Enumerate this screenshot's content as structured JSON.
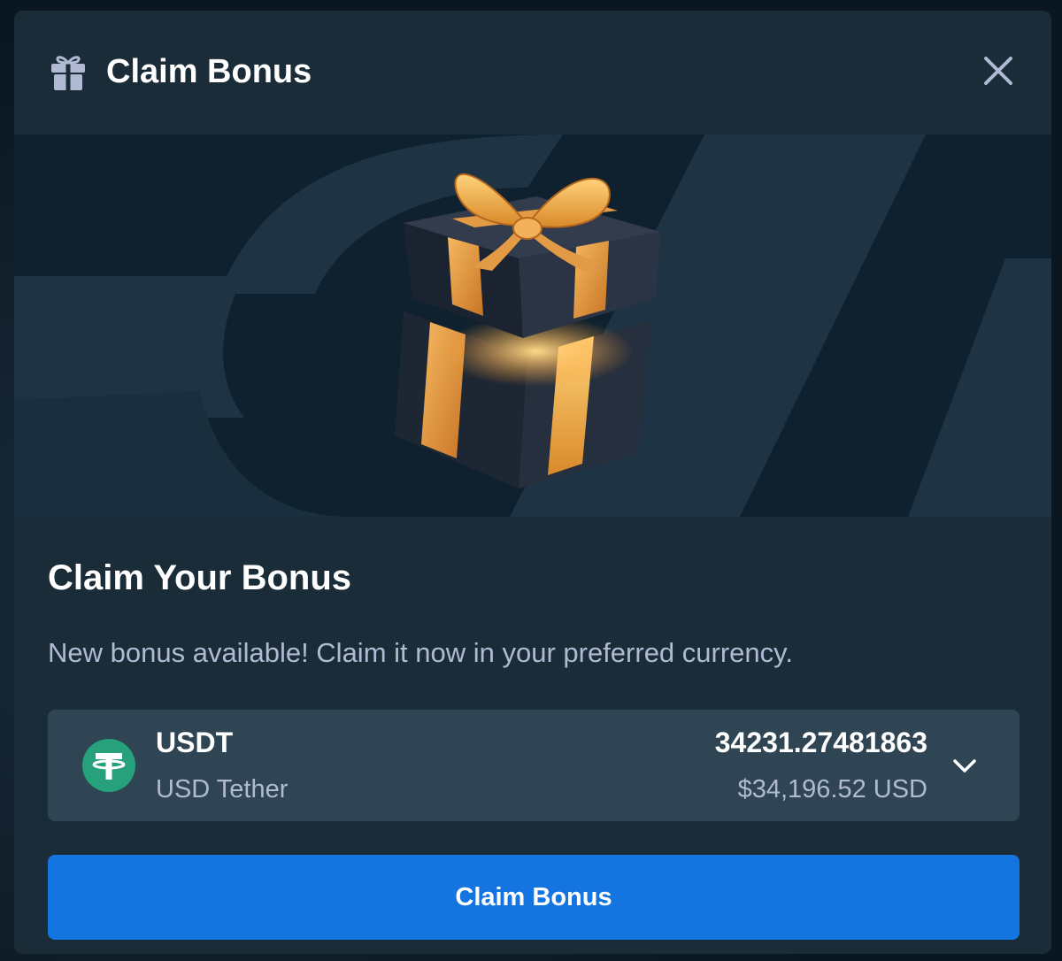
{
  "modal": {
    "title": "Claim Bonus",
    "header_icon": "gift-icon",
    "close_icon": "close-icon"
  },
  "hero": {
    "image": "gift-box-illustration"
  },
  "content": {
    "title": "Claim Your Bonus",
    "description": "New bonus available! Claim it now in your preferred currency."
  },
  "currency": {
    "icon": "tether-icon",
    "symbol": "USDT",
    "name": "USD Tether",
    "amount": "34231.27481863",
    "usd_value": "$34,196.52 USD",
    "dropdown_icon": "chevron-down-icon"
  },
  "claim_button": {
    "label": "Claim Bonus"
  },
  "colors": {
    "modal_bg": "#1a2c38",
    "hero_bg": "#0f212e",
    "select_bg": "#2f4553",
    "accent_blue": "#1475e1",
    "tether_green": "#26a17b",
    "muted_text": "#b1bad3"
  }
}
